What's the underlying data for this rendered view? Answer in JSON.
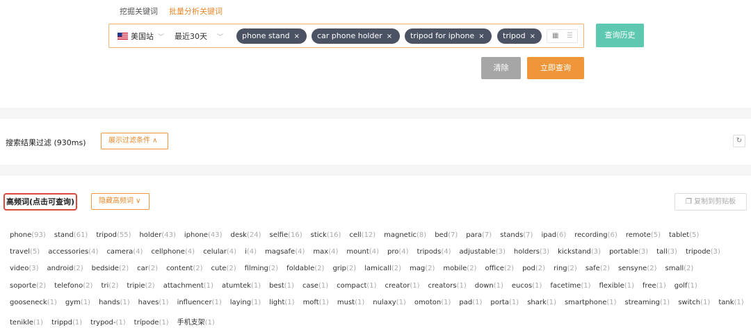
{
  "tabs": [
    {
      "label": "挖掘关键词"
    },
    {
      "label": "批量分析关键词"
    }
  ],
  "search": {
    "site_label": "美国站",
    "range_label": "最近30天",
    "chips": [
      {
        "label": "phone stand"
      },
      {
        "label": "car phone holder"
      },
      {
        "label": "tripod for iphone"
      },
      {
        "label": "tripod"
      }
    ],
    "chip_close": "×"
  },
  "buttons": {
    "history": "查询历史",
    "clear": "清除",
    "query": "立即查询"
  },
  "filter": {
    "title": "搜索结果过滤 (930ms)",
    "show_button": "展示过滤条件 ∧",
    "refresh_icon": "↻"
  },
  "high_freq": {
    "title": "高频词(点击可查询)",
    "hide_button": "隐藏高频词 ∨",
    "copy_button": "复制到剪贴板",
    "rows": [
      [
        [
          "phone",
          "(93)"
        ],
        [
          "stand",
          "(61)"
        ],
        [
          "tripod",
          "(55)"
        ],
        [
          "holder",
          "(43)"
        ],
        [
          "iphone",
          "(43)"
        ],
        [
          "desk",
          "(24)"
        ],
        [
          "selfie",
          "(16)"
        ],
        [
          "stick",
          "(16)"
        ],
        [
          "cell",
          "(12)"
        ],
        [
          "magnetic",
          "(8)"
        ],
        [
          "bed",
          "(7)"
        ],
        [
          "para",
          "(7)"
        ],
        [
          "stands",
          "(7)"
        ],
        [
          "ipad",
          "(6)"
        ],
        [
          "recording",
          "(6)"
        ],
        [
          "remote",
          "(5)"
        ],
        [
          "tablet",
          "(5)"
        ]
      ],
      [
        [
          "travel",
          "(5)"
        ],
        [
          "accessories",
          "(4)"
        ],
        [
          "camera",
          "(4)"
        ],
        [
          "cellphone",
          "(4)"
        ],
        [
          "celular",
          "(4)"
        ],
        [
          "i",
          "(4)"
        ],
        [
          "magsafe",
          "(4)"
        ],
        [
          "max",
          "(4)"
        ],
        [
          "mount",
          "(4)"
        ],
        [
          "pro",
          "(4)"
        ],
        [
          "tripods",
          "(4)"
        ],
        [
          "adjustable",
          "(3)"
        ],
        [
          "holders",
          "(3)"
        ],
        [
          "kickstand",
          "(3)"
        ],
        [
          "portable",
          "(3)"
        ],
        [
          "tall",
          "(3)"
        ],
        [
          "tripode",
          "(3)"
        ]
      ],
      [
        [
          "video",
          "(3)"
        ],
        [
          "android",
          "(2)"
        ],
        [
          "bedside",
          "(2)"
        ],
        [
          "car",
          "(2)"
        ],
        [
          "content",
          "(2)"
        ],
        [
          "cute",
          "(2)"
        ],
        [
          "filming",
          "(2)"
        ],
        [
          "foldable",
          "(2)"
        ],
        [
          "grip",
          "(2)"
        ],
        [
          "lamicall",
          "(2)"
        ],
        [
          "mag",
          "(2)"
        ],
        [
          "mobile",
          "(2)"
        ],
        [
          "office",
          "(2)"
        ],
        [
          "pod",
          "(2)"
        ],
        [
          "ring",
          "(2)"
        ],
        [
          "safe",
          "(2)"
        ],
        [
          "sensyne",
          "(2)"
        ],
        [
          "small",
          "(2)"
        ]
      ],
      [
        [
          "soporte",
          "(2)"
        ],
        [
          "telefono",
          "(2)"
        ],
        [
          "tri",
          "(2)"
        ],
        [
          "tripie",
          "(2)"
        ],
        [
          "attachment",
          "(1)"
        ],
        [
          "atumtek",
          "(1)"
        ],
        [
          "best",
          "(1)"
        ],
        [
          "case",
          "(1)"
        ],
        [
          "compact",
          "(1)"
        ],
        [
          "creator",
          "(1)"
        ],
        [
          "creators",
          "(1)"
        ],
        [
          "down",
          "(1)"
        ],
        [
          "eucos",
          "(1)"
        ],
        [
          "facetime",
          "(1)"
        ],
        [
          "flexible",
          "(1)"
        ],
        [
          "free",
          "(1)"
        ],
        [
          "golf",
          "(1)"
        ]
      ],
      [
        [
          "gooseneck",
          "(1)"
        ],
        [
          "gym",
          "(1)"
        ],
        [
          "hands",
          "(1)"
        ],
        [
          "haves",
          "(1)"
        ],
        [
          "influencer",
          "(1)"
        ],
        [
          "laying",
          "(1)"
        ],
        [
          "light",
          "(1)"
        ],
        [
          "moft",
          "(1)"
        ],
        [
          "must",
          "(1)"
        ],
        [
          "nulaxy",
          "(1)"
        ],
        [
          "omoton",
          "(1)"
        ],
        [
          "pad",
          "(1)"
        ],
        [
          "porta",
          "(1)"
        ],
        [
          "shark",
          "(1)"
        ],
        [
          "smartphone",
          "(1)"
        ],
        [
          "streaming",
          "(1)"
        ],
        [
          "switch",
          "(1)"
        ],
        [
          "tank",
          "(1)"
        ]
      ],
      [
        [
          "tenikle",
          "(1)"
        ],
        [
          "trippd",
          "(1)"
        ],
        [
          "trypod-",
          "(1)"
        ],
        [
          "trípode",
          "(1)"
        ],
        [
          "手机支架",
          "(1)"
        ]
      ]
    ]
  },
  "colors": {
    "accent": "#ee9639",
    "teal": "#5ec8b0",
    "chip_bg": "#4b5263",
    "highlight_border": "#d94a3a"
  }
}
